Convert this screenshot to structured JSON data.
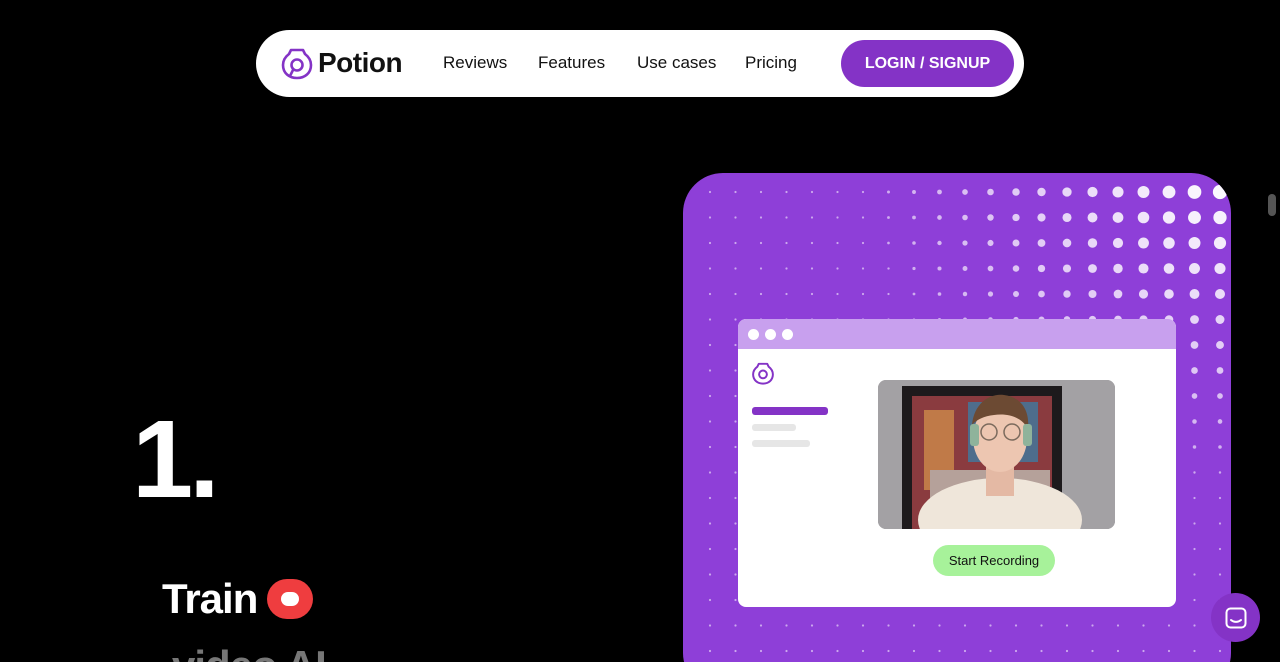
{
  "nav": {
    "brand": "Potion",
    "links": [
      "Reviews",
      "Features",
      "Use cases",
      "Pricing"
    ],
    "login_label": "LOGIN / SIGNUP"
  },
  "hero": {
    "step_number": "1.",
    "step_title": "Train",
    "step_subtitle": "video AI"
  },
  "card": {
    "start_recording_label": "Start Recording"
  },
  "colors": {
    "accent": "#8433c6",
    "card_bg": "#8e3fd8",
    "record_red": "#ef3d3f",
    "start_green": "#a7f29a"
  },
  "icons": {
    "brand_logo": "potion-logo-icon",
    "record": "record-icon",
    "chat": "chat-icon"
  }
}
